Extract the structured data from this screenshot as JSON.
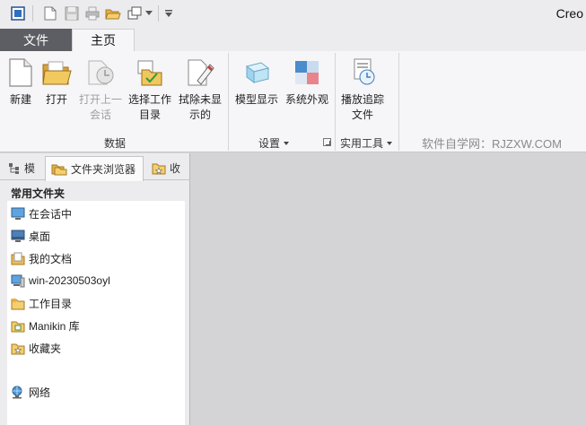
{
  "app": {
    "title": "Creo"
  },
  "tabs": [
    {
      "label": "文件"
    },
    {
      "label": "主页"
    }
  ],
  "ribbon": {
    "data_group": {
      "label": "数据",
      "buttons": [
        {
          "line1": "新建",
          "line2": ""
        },
        {
          "line1": "打开",
          "line2": ""
        },
        {
          "line1": "打开上一",
          "line2": "会话"
        },
        {
          "line1": "选择工作",
          "line2": "目录"
        },
        {
          "line1": "拭除未显",
          "line2": "示的"
        }
      ]
    },
    "settings_group": {
      "label": "设置",
      "buttons": [
        {
          "line1": "模型显示"
        },
        {
          "line1": "系统外观"
        }
      ]
    },
    "utilities_group": {
      "label": "实用工具",
      "buttons": [
        {
          "line1": "播放追踪",
          "line2": "文件"
        }
      ]
    },
    "watermark": "软件自学网：RJZXW.COM"
  },
  "navigator": {
    "tabs": [
      {
        "label": "模"
      },
      {
        "label": "文件夹浏览器"
      },
      {
        "label": "收"
      }
    ],
    "section_title": "常用文件夹",
    "items": [
      {
        "label": "在会话中",
        "icon": "monitor-icon"
      },
      {
        "label": "桌面",
        "icon": "desktop-icon"
      },
      {
        "label": "我的文档",
        "icon": "documents-icon"
      },
      {
        "label": "win-20230503oyl",
        "icon": "computer-icon"
      },
      {
        "label": "工作目录",
        "icon": "working-directory-icon"
      },
      {
        "label": "Manikin 库",
        "icon": "library-icon"
      },
      {
        "label": "收藏夹",
        "icon": "favorites-icon"
      },
      {
        "label": "网络",
        "icon": "network-icon"
      }
    ]
  },
  "colors": {
    "file_tab": "#5c5e63",
    "ribbon_bg": "#f6f6f8",
    "main_bg": "#d4d4d6"
  }
}
